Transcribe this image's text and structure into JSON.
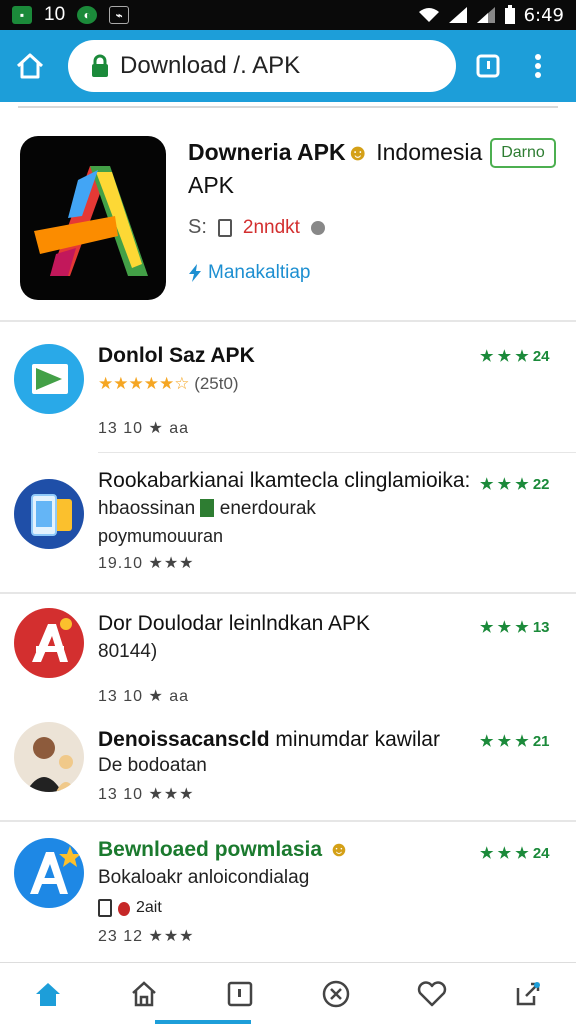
{
  "status_bar": {
    "left_number": "10",
    "time": "6:49"
  },
  "browser": {
    "url": "Download /. APK"
  },
  "featured": {
    "title_bold": "Downeria APK",
    "title_rest": " Indomesia APK",
    "badge": "Darno",
    "meta_prefix": "S:",
    "meta_red": "2nndkt",
    "link": "Manakaltiap"
  },
  "items": [
    {
      "title": "Donlol Saz APK",
      "sub": "",
      "stars": "★★★★★☆",
      "rating_count": "(25t0)",
      "meta": "13 10 ★ aa",
      "rating": "★ ★ ★ 24"
    },
    {
      "title": "Rookabarkianai lkamtecla clinglamioika:",
      "sub": "hbaossinan",
      "sub2": "enerdourak",
      "sub3": "poymumouuran",
      "meta": "19.10 ★★★",
      "rating": "★ ★ ★ 22"
    },
    {
      "title": "Dor Doulodar leinlndkan APK",
      "sub": "80144)",
      "meta": "13 10 ★ aa",
      "rating": "★ ★ ★ 13"
    },
    {
      "title_bold": "Denoissacanscld",
      "title_rest": " minumdar kawilar",
      "sub": "De bodoatan",
      "meta": "13 10 ★★★",
      "rating": "★ ★ ★ 21"
    },
    {
      "title": "Bewnloaed powmlasia",
      "sub": "Bokaloakr anloicondialag",
      "meta_small": "2ait",
      "meta": "23 12 ★★★",
      "rating": "★ ★ ★ 24"
    }
  ],
  "colors": {
    "accent": "#1d9ed9",
    "green": "#1b8a3a",
    "badge_green": "#4caf50"
  },
  "nav": [
    "home-filled-icon",
    "home-icon",
    "tab-icon",
    "close-circle-icon",
    "heart-icon",
    "share-icon"
  ]
}
